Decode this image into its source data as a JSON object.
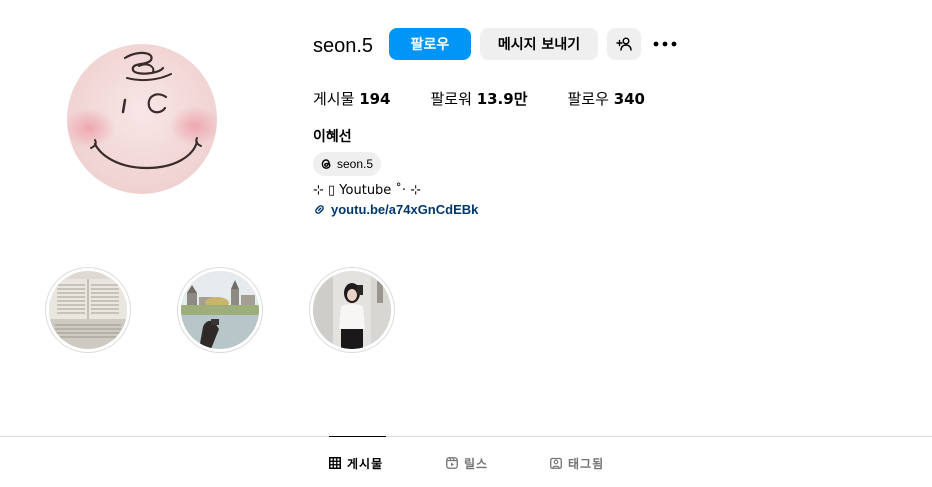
{
  "profile": {
    "username": "seon.5",
    "follow_label": "팔로우",
    "message_label": "메시지 보내기",
    "full_name": "이혜선",
    "threads_handle": "seon.5",
    "bio": "⊹ ▯ Youtube ˚‧ ⊹",
    "link": "youtu.be/a74xGnCdEBk"
  },
  "stats": {
    "posts_label": "게시물",
    "posts_value": "194",
    "followers_label": "팔로워",
    "followers_value": "13.9만",
    "following_label": "팔로우",
    "following_value": "340"
  },
  "highlights": [
    {
      "icon": "book-page-thumbnail"
    },
    {
      "icon": "castle-lake-thumbnail"
    },
    {
      "icon": "mirror-selfie-thumbnail"
    }
  ],
  "tabs": [
    {
      "label": "게시물",
      "icon": "grid-icon",
      "active": true
    },
    {
      "label": "릴스",
      "icon": "reels-icon",
      "active": false
    },
    {
      "label": "태그됨",
      "icon": "tagged-icon",
      "active": false
    }
  ],
  "colors": {
    "accent": "#0095f6",
    "button_grey": "#efefef",
    "link": "#00376b",
    "divider": "#dbdbdb",
    "muted_text": "#737373",
    "avatar_bg": "#f6dede"
  }
}
